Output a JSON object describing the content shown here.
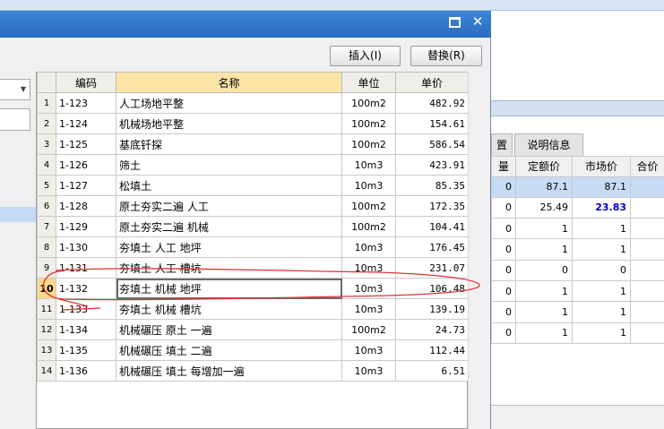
{
  "dialog": {
    "maximize_icon": "maximize-icon",
    "close_icon": "close-icon",
    "close_glyph": "✕",
    "insert_label": "插入(I)",
    "replace_label": "替换(R)"
  },
  "grid": {
    "headers": {
      "code": "编码",
      "name": "名称",
      "unit": "单位",
      "price": "单价"
    },
    "rows": [
      {
        "n": "1",
        "code": "1-123",
        "name": "人工场地平整",
        "unit": "100m2",
        "price": "482.92"
      },
      {
        "n": "2",
        "code": "1-124",
        "name": "机械场地平整",
        "unit": "100m2",
        "price": "154.61"
      },
      {
        "n": "3",
        "code": "1-125",
        "name": "基底钎探",
        "unit": "100m2",
        "price": "586.54"
      },
      {
        "n": "4",
        "code": "1-126",
        "name": "筛土",
        "unit": "10m3",
        "price": "423.91"
      },
      {
        "n": "5",
        "code": "1-127",
        "name": "松填土",
        "unit": "10m3",
        "price": "85.35"
      },
      {
        "n": "6",
        "code": "1-128",
        "name": "原土夯实二遍 人工",
        "unit": "100m2",
        "price": "172.35"
      },
      {
        "n": "7",
        "code": "1-129",
        "name": "原土夯实二遍 机械",
        "unit": "100m2",
        "price": "104.41"
      },
      {
        "n": "8",
        "code": "1-130",
        "name": "夯填土 人工 地坪",
        "unit": "10m3",
        "price": "176.45"
      },
      {
        "n": "9",
        "code": "1-131",
        "name": "夯填土 人工 槽坑",
        "unit": "10m3",
        "price": "231.07"
      },
      {
        "n": "10",
        "code": "1-132",
        "name": "夯填土 机械 地坪",
        "unit": "10m3",
        "price": "106.48"
      },
      {
        "n": "11",
        "code": "1-133",
        "name": "夯填土 机械 槽坑",
        "unit": "10m3",
        "price": "139.19"
      },
      {
        "n": "12",
        "code": "1-134",
        "name": "机械碾压 原土 一遍",
        "unit": "100m2",
        "price": "24.73"
      },
      {
        "n": "13",
        "code": "1-135",
        "name": "机械碾压 填土 二遍",
        "unit": "10m3",
        "price": "112.44"
      },
      {
        "n": "14",
        "code": "1-136",
        "name": "机械碾压 填土 每增加一遍",
        "unit": "10m3",
        "price": "6.51"
      }
    ]
  },
  "background": {
    "tab1_label": "置",
    "tab2_label": "说明信息",
    "headers": {
      "c1": "量",
      "c2": "定额价",
      "c3": "市场价",
      "c4": "合价"
    },
    "rows": [
      {
        "q": "0",
        "quota": "87.1",
        "market": "87.1"
      },
      {
        "q": "0",
        "quota": "25.49",
        "market": "23.83"
      },
      {
        "q": "0",
        "quota": "1",
        "market": "1"
      },
      {
        "q": "0",
        "quota": "1",
        "market": "1"
      },
      {
        "q": "0",
        "quota": "0",
        "market": "0"
      },
      {
        "q": "0",
        "quota": "1",
        "market": "1"
      },
      {
        "q": "0",
        "quota": "1",
        "market": "1"
      },
      {
        "q": "0",
        "quota": "1",
        "market": "1"
      }
    ]
  },
  "colors": {
    "titlebar": "#2f74c8",
    "selection": "#c5dbf5",
    "row_marker": "#fbd98a",
    "annotation": "#e0303a",
    "highlight_value": "#0000cc"
  }
}
